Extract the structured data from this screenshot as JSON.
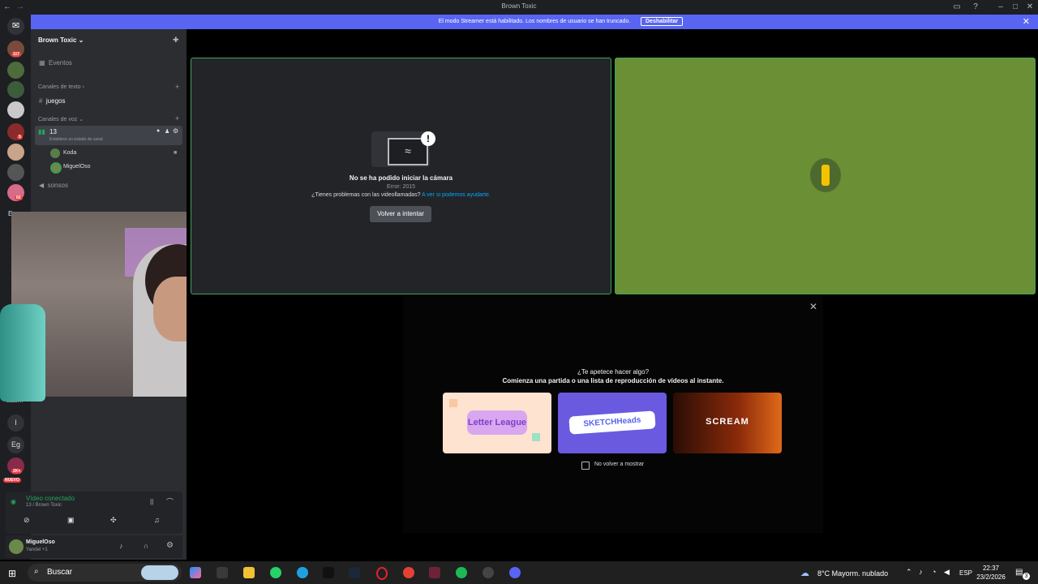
{
  "window": {
    "title": "Brown Toxic"
  },
  "banner": {
    "text": "El modo Streamer está habilitado. Los nombres de usuario se han truncado.",
    "button": "Deshabilitar"
  },
  "rail": {
    "badges": [
      "117",
      "5",
      "60",
      "2K+"
    ],
    "labels": [
      "E",
      "Eadin...",
      "I",
      "Eg"
    ],
    "nuevo": "NUEVO"
  },
  "sidebar": {
    "server_name": "Brown Toxic",
    "events": "Eventos",
    "text_category": "Canales de texto",
    "text_channel": "juegos",
    "voice_category": "Canales de voz",
    "voice_channel": "13",
    "voice_status": "Establece un estado de canal",
    "members": [
      "Koda",
      "MiguelOso"
    ],
    "other_channel": "sonsos"
  },
  "voice_panel": {
    "status": "Vídeo conectado",
    "sub": "13 / Brown Toxic"
  },
  "user": {
    "name": "MiguelOso",
    "status": "Yandel +1"
  },
  "camera_error": {
    "title": "No se ha podido iniciar la cámara",
    "error": "Error: 2015",
    "help": "¿Tienes problemas con las videollamadas?",
    "help_link": "A ver si podemos ayudarte.",
    "retry": "Volver a intentar"
  },
  "activity": {
    "title": "¿Te apetece hacer algo?",
    "subtitle": "Comienza una partida o una lista de reproducción de vídeos al instante.",
    "games": [
      "Letter League",
      "SKETCHHeads",
      "SCREAM"
    ],
    "checkbox": "No volver a mostrar"
  },
  "taskbar": {
    "search": "Buscar",
    "weather": "8°C  Mayorm. nublado",
    "lang": "ESP",
    "time": "22:37",
    "date": "23/2/2026",
    "notif": "3"
  },
  "colors": {
    "brand": "#5865f2",
    "green_tile": "#6a8f35",
    "speaking_border": "#43a25a",
    "link": "#00a8fc"
  }
}
